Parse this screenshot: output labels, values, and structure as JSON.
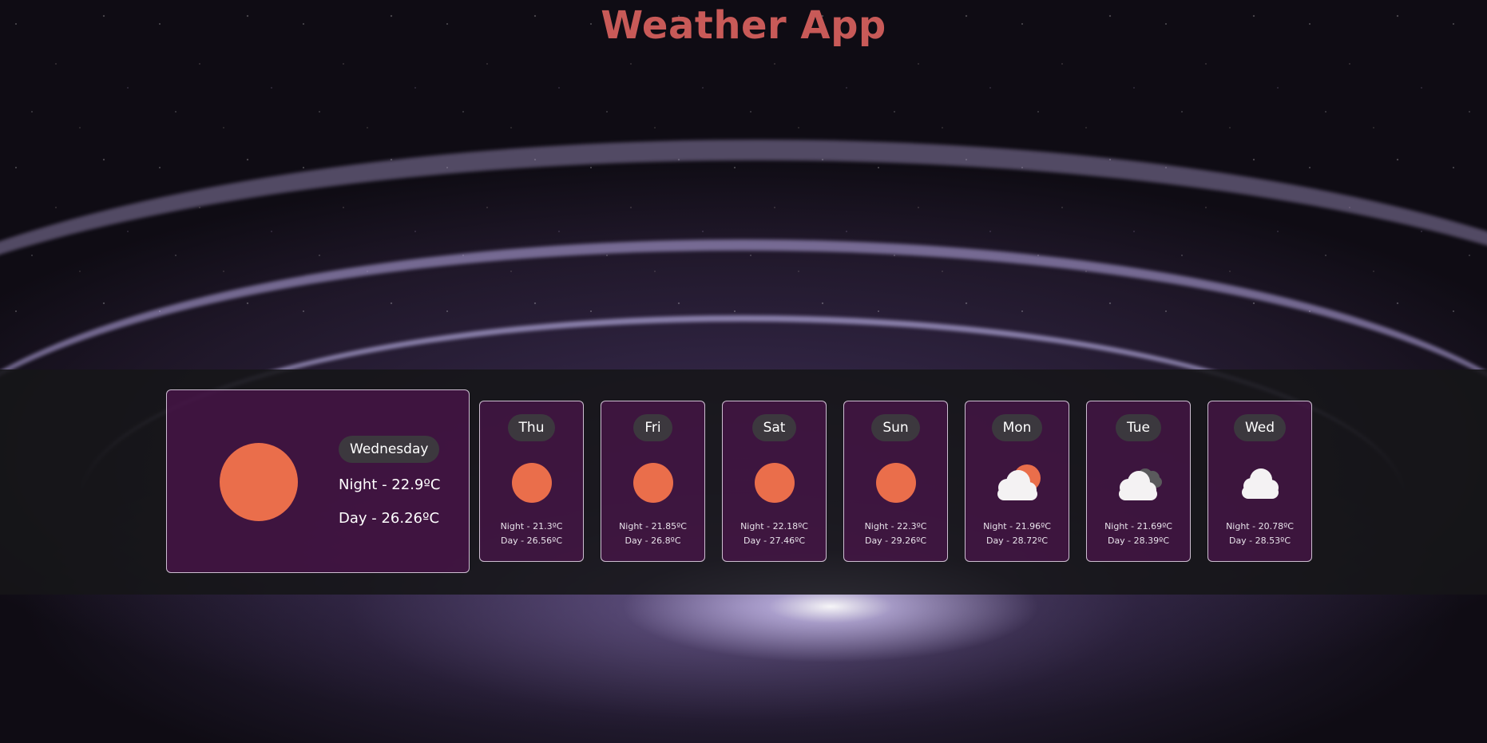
{
  "app": {
    "title": "Weather App"
  },
  "colors": {
    "title": "#c85a58",
    "sun": "#ea6e4b",
    "card_bg": "#4e144e",
    "band_bg": "#161618"
  },
  "today": {
    "day": "Wednesday",
    "night": "Night - 22.9ºC",
    "day_temp": "Day - 26.26ºC",
    "icon": "sun-icon"
  },
  "forecast": [
    {
      "day": "Thu",
      "night": "Night - 21.3ºC",
      "day_temp": "Day - 26.56ºC",
      "icon": "sun-icon"
    },
    {
      "day": "Fri",
      "night": "Night - 21.85ºC",
      "day_temp": "Day - 26.8ºC",
      "icon": "sun-icon"
    },
    {
      "day": "Sat",
      "night": "Night - 22.18ºC",
      "day_temp": "Day - 27.46ºC",
      "icon": "sun-icon"
    },
    {
      "day": "Sun",
      "night": "Night - 22.3ºC",
      "day_temp": "Day - 29.26ºC",
      "icon": "sun-icon"
    },
    {
      "day": "Mon",
      "night": "Night - 21.96ºC",
      "day_temp": "Day - 28.72ºC",
      "icon": "partly-cloudy-icon"
    },
    {
      "day": "Tue",
      "night": "Night - 21.69ºC",
      "day_temp": "Day - 28.39ºC",
      "icon": "broken-clouds-icon"
    },
    {
      "day": "Wed",
      "night": "Night - 20.78ºC",
      "day_temp": "Day - 28.53ºC",
      "icon": "cloud-icon"
    }
  ]
}
